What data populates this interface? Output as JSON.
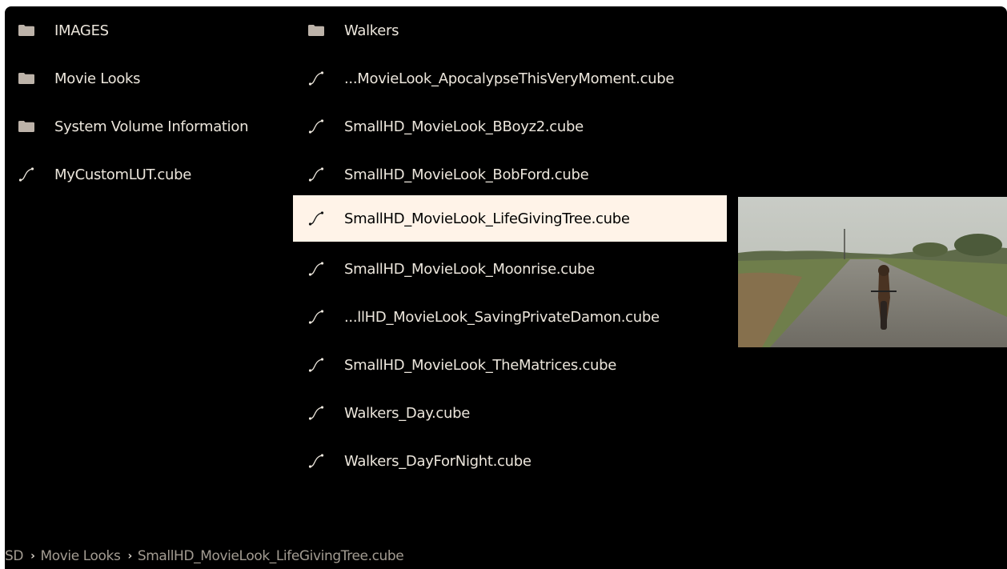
{
  "left_column": {
    "items": [
      {
        "label": "IMAGES",
        "icon": "folder-icon"
      },
      {
        "label": "Movie Looks",
        "icon": "folder-icon"
      },
      {
        "label": "System Volume Information",
        "icon": "folder-icon"
      },
      {
        "label": "MyCustomLUT.cube",
        "icon": "lut-curve-icon"
      }
    ]
  },
  "right_column": {
    "selected_index": 3,
    "items": [
      {
        "label": "Walkers",
        "icon": "folder-icon"
      },
      {
        "label": "...MovieLook_ApocalypseThisVeryMoment.cube",
        "icon": "lut-curve-icon"
      },
      {
        "label": "SmallHD_MovieLook_BBoyz2.cube",
        "icon": "lut-curve-icon"
      },
      {
        "label": "SmallHD_MovieLook_BobFord.cube",
        "icon": "lut-curve-icon"
      },
      {
        "label": "SmallHD_MovieLook_LifeGivingTree.cube",
        "icon": "lut-curve-icon"
      },
      {
        "label": "SmallHD_MovieLook_Moonrise.cube",
        "icon": "lut-curve-icon"
      },
      {
        "label": "...llHD_MovieLook_SavingPrivateDamon.cube",
        "icon": "lut-curve-icon"
      },
      {
        "label": "SmallHD_MovieLook_TheMatrices.cube",
        "icon": "lut-curve-icon"
      },
      {
        "label": "Walkers_Day.cube",
        "icon": "lut-curve-icon"
      },
      {
        "label": "Walkers_DayForNight.cube",
        "icon": "lut-curve-icon"
      }
    ]
  },
  "breadcrumb": {
    "root": "SD",
    "folder": "Movie Looks",
    "file": "SmallHD_MovieLook_LifeGivingTree.cube",
    "separator": "›"
  },
  "colors": {
    "background": "#000000",
    "text": "#ece6dc",
    "selected_bg": "#fff3e8",
    "folder_icon": "#bdb3a9",
    "breadcrumb_text": "#a39c92"
  }
}
